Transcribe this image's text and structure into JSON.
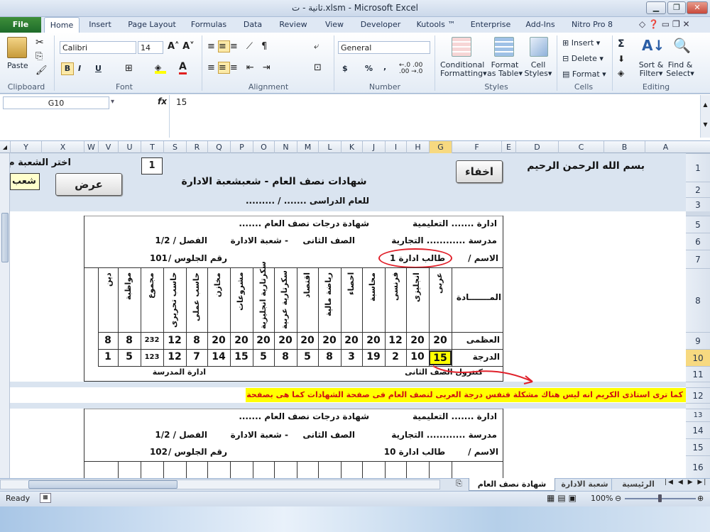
{
  "window": {
    "title": "ثانية - ت.xlsm - Microsoft Excel"
  },
  "ribbon_tabs": [
    "File",
    "Home",
    "Insert",
    "Page Layout",
    "Formulas",
    "Data",
    "Review",
    "View",
    "Developer",
    "Kutools ™",
    "Enterprise",
    "Add-Ins",
    "Nitro Pro 8"
  ],
  "clipboard": {
    "paste": "Paste",
    "group": "Clipboard"
  },
  "font": {
    "name": "Calibri",
    "size": "14",
    "group": "Font",
    "bold": "B",
    "italic": "I",
    "underline": "U"
  },
  "alignment": {
    "group": "Alignment"
  },
  "number": {
    "format": "General",
    "currency": "$",
    "percent": "%",
    "comma": ",",
    "group": "Number"
  },
  "styles": {
    "conditional": "Conditional",
    "conditional2": "Formatting",
    "format_table": "Format",
    "format_table2": "as Table",
    "cell_styles": "Cell",
    "cell_styles2": "Styles",
    "group": "Styles"
  },
  "cells": {
    "insert": "Insert",
    "delete": "Delete",
    "format": "Format",
    "group": "Cells"
  },
  "editing": {
    "sigma": "Σ",
    "sort": "Sort &",
    "sort2": "Filter",
    "find": "Find &",
    "find2": "Select",
    "group": "Editing"
  },
  "formula_bar": {
    "name_box": "G10",
    "fx": "fx",
    "value": "15"
  },
  "columns": [
    "Y",
    "X",
    "W",
    "V",
    "U",
    "T",
    "S",
    "R",
    "Q",
    "P",
    "O",
    "N",
    "M",
    "L",
    "K",
    "J",
    "I",
    "H",
    "G",
    "F",
    "E",
    "D",
    "C",
    "B",
    "A"
  ],
  "rows": [
    "1",
    "2",
    "3",
    "5",
    "6",
    "7",
    "8",
    "9",
    "10",
    "11",
    "12",
    "13",
    "14",
    "15",
    "16"
  ],
  "header_area": {
    "bismillah": "بسم الله الرحمن الرحيم",
    "hide_button": "اخفاء",
    "show_button": "عرض",
    "choose_branch": "اختر الشعبة م",
    "branch_button": "شعب",
    "counter": "1",
    "title": "شهادات نصف العام - شعبشعبة الادارة",
    "year": "للعام الدراسى ....... / ........."
  },
  "certificate": {
    "admin": "ادارة ....... التعليمية",
    "school": "مدرسة ............ التجارية",
    "title": "شهادة درجات نصف العام .......",
    "grade": "الصف الثانى",
    "dash_branch": "- شعبة الادارة",
    "term": "الفصل / 1/2",
    "name_label": "الاسم  /",
    "student_name": "طالب ادارة 1",
    "seat_label": "رقم الجلوس /",
    "seat_no": "101",
    "subject_label": "المـــــــادة",
    "max_label": "العظمى",
    "score_label": "الدرجة",
    "subjects": [
      "عربى",
      "انجليزى",
      "فرنسى",
      "محاسبة",
      "احصاء",
      "رياضة مالية",
      "اقتصاد",
      "سكرتارية عربية",
      "سكرتارية انجليزية",
      "مشروعات",
      "مخازن",
      "حاسب عملى",
      "حاسب تحريرى",
      "مجموع",
      "مواظبة",
      "دين"
    ],
    "max_values": [
      "20",
      "20",
      "12",
      "20",
      "20",
      "20",
      "20",
      "20",
      "20",
      "20",
      "20",
      "8",
      "12",
      "232",
      "8",
      "8"
    ],
    "score_values": [
      "15",
      "10",
      "2",
      "19",
      "3",
      "8",
      "5",
      "8",
      "5",
      "15",
      "14",
      "7",
      "12",
      "123",
      "5",
      "1"
    ],
    "controller": "كنترول الصف الثانى",
    "school_admin": "ادارة المدرسة"
  },
  "note": "كما ترى استاذى الكريم انه ليس هناك مشكلة فنفس درجة العربى لنصف العام  فى صفحة الشهادات كما هى بصفحة شعبة الإدارة",
  "certificate2": {
    "admin": "ادارة ....... التعليمية",
    "school": "مدرسة ............ التجارية",
    "title": "شهادة درجات نصف العام .......",
    "grade": "الصف الثانى",
    "dash_branch": "- شعبة الادارة",
    "term": "الفصل / 1/2",
    "name_label": "الاسم  /",
    "student_name": "طالب ادارة 10",
    "seat_label": "رقم الجلوس /",
    "seat_no": "102"
  },
  "sheet_tabs": [
    "شهادة نصف العام",
    "شعبة الادارة",
    "الرئيسية"
  ],
  "status": {
    "ready": "Ready",
    "zoom": "100%"
  },
  "colors": {
    "highlight_yellow": "#ffff00",
    "annotation_red": "#e0202a",
    "band_blue": "#dae4f0"
  }
}
